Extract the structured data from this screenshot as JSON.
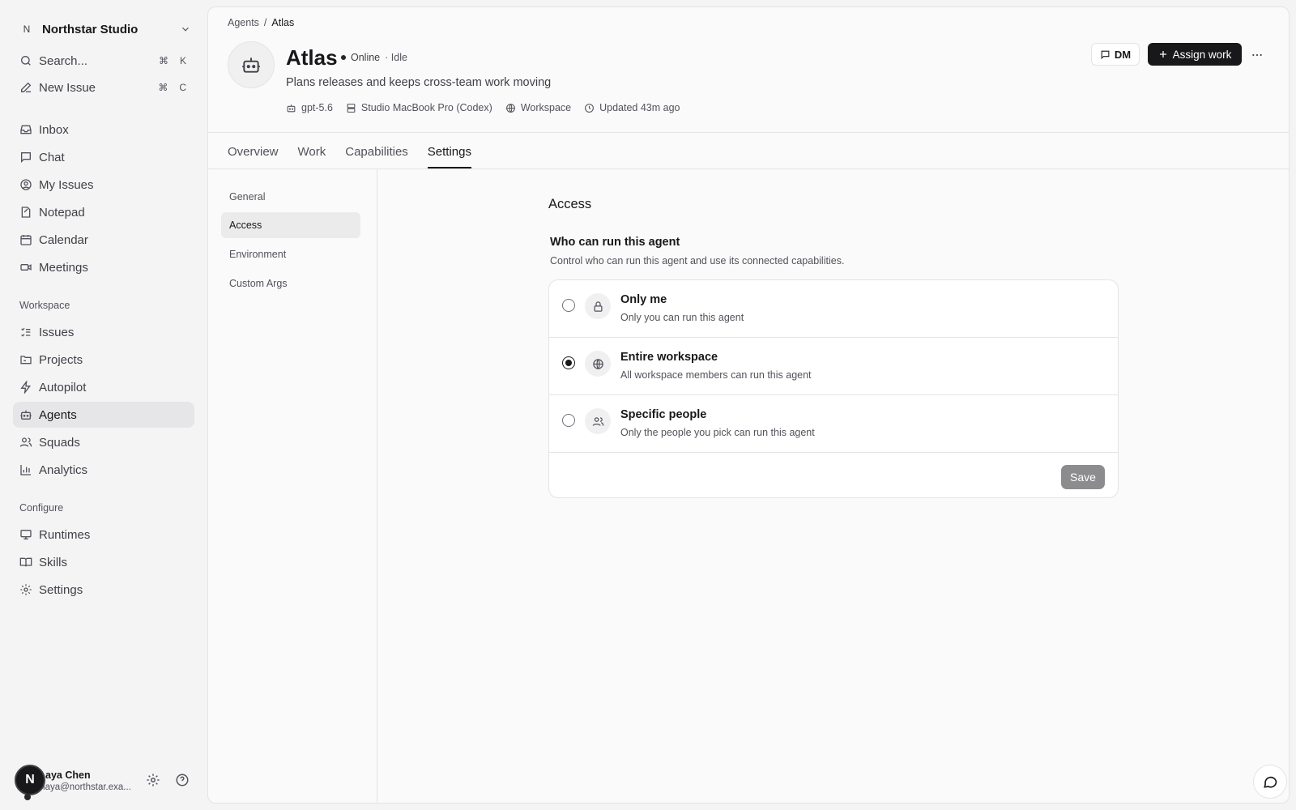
{
  "workspace": {
    "badge": "N",
    "name": "Northstar Studio"
  },
  "search": {
    "label": "Search...",
    "kbd_mod": "⌘",
    "kbd_key": "K"
  },
  "new_issue": {
    "label": "New Issue",
    "kbd_mod": "⌘",
    "kbd_key": "C"
  },
  "nav_primary": [
    {
      "label": "Inbox",
      "icon": "inbox-icon"
    },
    {
      "label": "Chat",
      "icon": "chat-icon"
    },
    {
      "label": "My Issues",
      "icon": "user-circle-icon"
    },
    {
      "label": "Notepad",
      "icon": "notepad-icon"
    },
    {
      "label": "Calendar",
      "icon": "calendar-icon"
    },
    {
      "label": "Meetings",
      "icon": "video-icon"
    }
  ],
  "workspace_section": {
    "title": "Workspace",
    "items": [
      {
        "label": "Issues",
        "icon": "list-icon"
      },
      {
        "label": "Projects",
        "icon": "folder-icon"
      },
      {
        "label": "Autopilot",
        "icon": "bolt-icon"
      },
      {
        "label": "Agents",
        "icon": "robot-icon",
        "active": true
      },
      {
        "label": "Squads",
        "icon": "users-icon"
      },
      {
        "label": "Analytics",
        "icon": "bar-chart-icon"
      }
    ]
  },
  "configure_section": {
    "title": "Configure",
    "items": [
      {
        "label": "Runtimes",
        "icon": "monitor-icon"
      },
      {
        "label": "Skills",
        "icon": "book-icon"
      },
      {
        "label": "Settings",
        "icon": "gear-icon"
      }
    ]
  },
  "user": {
    "avatar": "N",
    "name": "aya Chen",
    "email": "maya@northstar.exa..."
  },
  "breadcrumb": {
    "parent": "Agents",
    "sep": "/",
    "current": "Atlas"
  },
  "agent": {
    "name": "Atlas",
    "status": "Online",
    "activity": "· Idle",
    "description": "Plans releases and keeps cross-team work moving",
    "model": "gpt-5.6",
    "runtime": "Studio MacBook Pro (Codex)",
    "scope": "Workspace",
    "updated": "Updated 43m ago"
  },
  "actions": {
    "dm": "DM",
    "assign": "Assign work"
  },
  "tabs": [
    "Overview",
    "Work",
    "Capabilities",
    "Settings"
  ],
  "active_tab": "Settings",
  "settings_nav": [
    "General",
    "Access",
    "Environment",
    "Custom Args"
  ],
  "active_settings": "Access",
  "access": {
    "title": "Access",
    "heading": "Who can run this agent",
    "description": "Control who can run this agent and use its connected capabilities.",
    "options": [
      {
        "title": "Only me",
        "desc": "Only you can run this agent",
        "icon": "lock-icon",
        "selected": false
      },
      {
        "title": "Entire workspace",
        "desc": "All workspace members can run this agent",
        "icon": "globe-icon",
        "selected": true
      },
      {
        "title": "Specific people",
        "desc": "Only the people you pick can run this agent",
        "icon": "users-icon",
        "selected": false
      }
    ],
    "save": "Save"
  }
}
